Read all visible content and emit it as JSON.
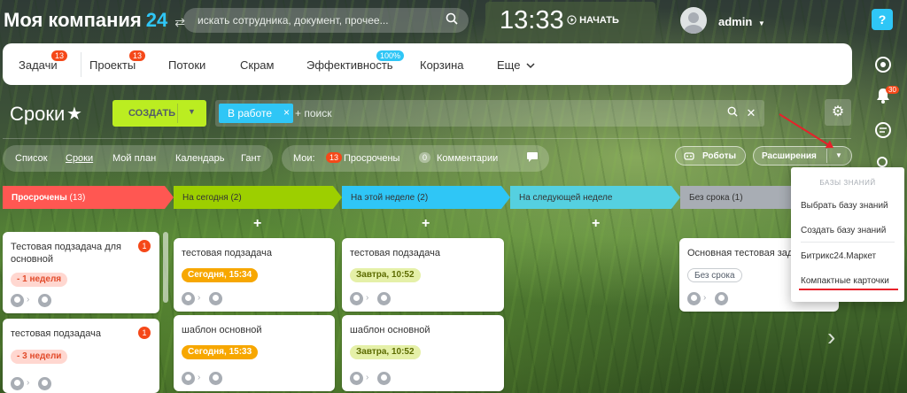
{
  "header": {
    "company": "Моя компания",
    "company_num": "24",
    "swap_glyph": "⇄",
    "search_placeholder": "искать сотрудника, документ, прочее...",
    "time": "13:33",
    "start_label": "НАЧАТЬ",
    "user": "admin",
    "help": "?"
  },
  "rail": {
    "bell_badge": "30"
  },
  "nav": {
    "items": [
      {
        "label": "Задачи",
        "badge": "13"
      },
      {
        "label": "Проекты",
        "badge": "13"
      },
      {
        "label": "Потоки"
      },
      {
        "label": "Скрам"
      },
      {
        "label": "Эффективность",
        "badge": "100%"
      },
      {
        "label": "Корзина"
      },
      {
        "label": "Еще"
      }
    ]
  },
  "toolbar": {
    "title": "Сроки",
    "create": "СОЗДАТЬ",
    "filter_chip": "В работе",
    "filter_placeholder": "+ поиск"
  },
  "views": {
    "items": [
      "Список",
      "Сроки",
      "Мой план",
      "Календарь",
      "Гант"
    ],
    "my_label": "Мои:",
    "overdue_count": "13",
    "overdue_label": "Просрочены",
    "comments_count": "0",
    "comments_label": "Комментарии",
    "robots": "Роботы",
    "extensions": "Расширения"
  },
  "columns": [
    {
      "title": "Просрочены",
      "count": "(13)",
      "color": "#ff5752"
    },
    {
      "title": "На сегодня",
      "count": "(2)",
      "color": "#9dcf00"
    },
    {
      "title": "На этой неделе",
      "count": "(2)",
      "color": "#2fc6f6"
    },
    {
      "title": "На следующей неделе",
      "count": "",
      "color": "#55d0e0"
    },
    {
      "title": "Без срока",
      "count": "(1)",
      "color": "#a8adb4"
    }
  ],
  "cards": {
    "c1": {
      "title": "Тестовая подзадача для основной",
      "badge": "1",
      "deadline": "- 1 неделя"
    },
    "c2": {
      "title": "тестовая подзадача",
      "badge": "1",
      "deadline": "- 3 недели"
    },
    "c3": {
      "title": "тестовая подзадача",
      "deadline": "Сегодня, 15:34"
    },
    "c4": {
      "title": "шаблон основной",
      "deadline": "Сегодня, 15:33"
    },
    "c5": {
      "title": "тестовая подзадача",
      "deadline": "Завтра, 10:52"
    },
    "c6": {
      "title": "шаблон основной",
      "deadline": "Завтра, 10:52"
    },
    "c7": {
      "title": "Основная тестовая задача",
      "deadline": "Без срока"
    }
  },
  "menu": {
    "header": "БАЗЫ ЗНАНИЙ",
    "items": [
      "Выбрать базу знаний",
      "Создать базу знаний",
      "Битрикс24.Маркет",
      "Компактные карточки"
    ]
  },
  "icons": {
    "search": "search-icon",
    "play": "play-icon",
    "star": "star-icon",
    "gear": "gear-icon",
    "close": "close-icon",
    "chat": "chat-icon",
    "bell": "bell-icon",
    "chevron": "chevron-right-icon"
  }
}
